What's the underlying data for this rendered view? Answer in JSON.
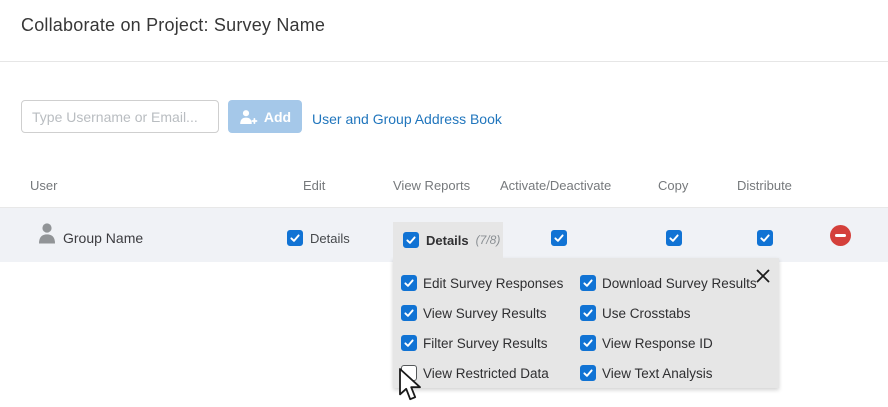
{
  "header": {
    "title": "Collaborate on Project: Survey Name"
  },
  "toolbar": {
    "input_placeholder": "Type Username or Email...",
    "add_label": "Add",
    "address_book_link": "User and Group Address Book"
  },
  "table": {
    "columns": [
      "User",
      "Edit",
      "View Reports",
      "Activate/Deactivate",
      "Copy",
      "Distribute"
    ],
    "row": {
      "user_name": "Group Name",
      "edit": {
        "label": "Details",
        "checked": true
      },
      "view_reports": {
        "label": "Details",
        "count": "(7/8)",
        "checked": true
      },
      "activate": {
        "checked": true
      },
      "copy": {
        "checked": true
      },
      "distribute": {
        "checked": true
      }
    }
  },
  "popup": {
    "permissions": [
      {
        "label": "Edit Survey Responses",
        "checked": true
      },
      {
        "label": "Download Survey Results",
        "checked": true
      },
      {
        "label": "View Survey Results",
        "checked": true
      },
      {
        "label": "Use Crosstabs",
        "checked": true
      },
      {
        "label": "Filter Survey Results",
        "checked": true
      },
      {
        "label": "View Response ID",
        "checked": true
      },
      {
        "label": "View Restricted Data",
        "checked": false
      },
      {
        "label": "View Text Analysis",
        "checked": true
      }
    ]
  },
  "colors": {
    "checkbox_blue": "#1173d4",
    "add_button_bg": "#a5c8e9",
    "link_blue": "#2176bd",
    "remove_red": "#d4403b",
    "row_bg": "#f0f2f6",
    "popup_bg": "#e6e6e6"
  }
}
